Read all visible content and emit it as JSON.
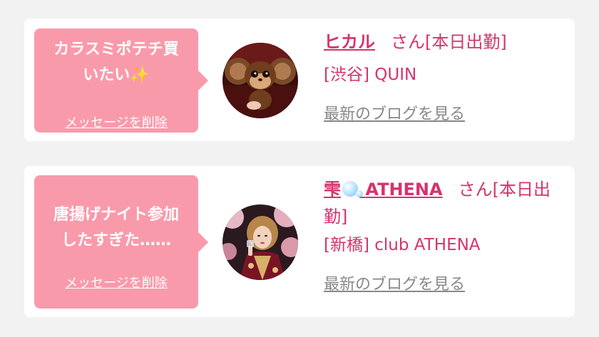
{
  "messages": [
    {
      "bubble_text": "カラスミポテチ買\nいたい✨",
      "delete_label": "メッセージを削除",
      "name": "ヒカル",
      "name_suffix": "さん[本日出勤]",
      "location": "[渋谷] QUIN",
      "blog_label": "最新のブログを見る"
    },
    {
      "bubble_text": "唐揚げナイト参加\nしたすぎた……",
      "delete_label": "メッセージを削除",
      "name_prefix": "雫",
      "name_emoji": "bubbles-icon",
      "name": "ATHENA",
      "name_suffix": "さん[本日出\n勤]",
      "location": "[新橋] club ATHENA",
      "blog_label": "最新のブログを見る"
    }
  ],
  "colors": {
    "bubble": "#f99aab",
    "accent": "#d6336c",
    "link_gray": "#888888",
    "background": "#f2f2f2"
  }
}
